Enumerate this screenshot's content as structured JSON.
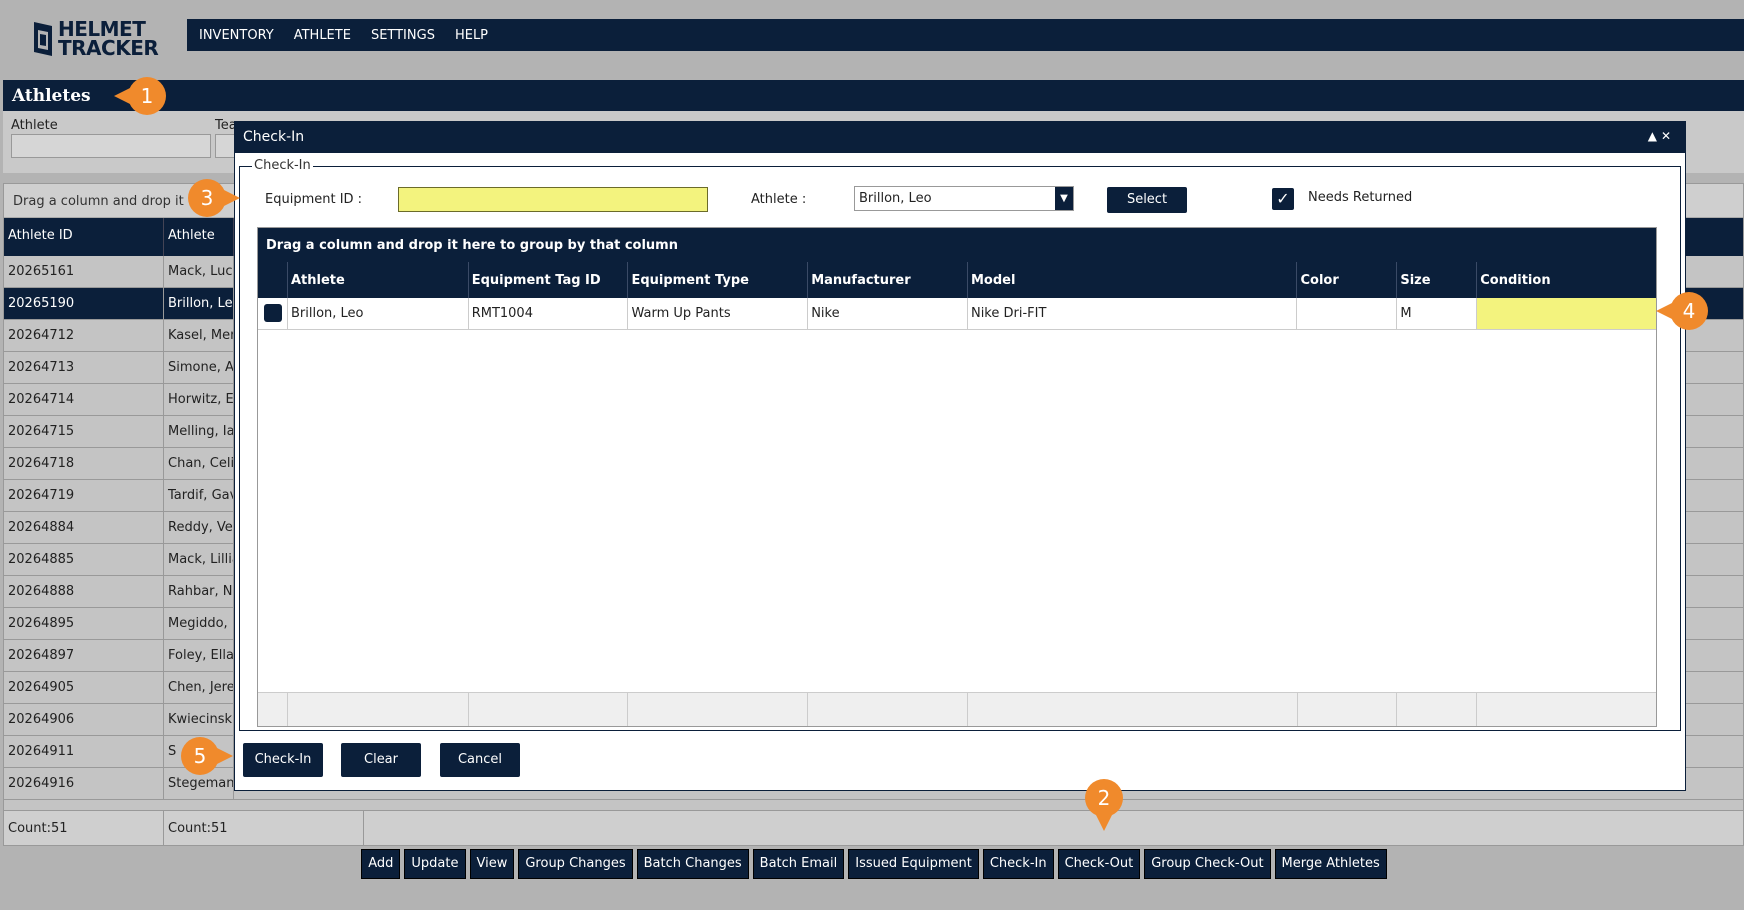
{
  "app": {
    "logo_line1": "HELMET",
    "logo_line2": "TRACKER"
  },
  "topnav": [
    "INVENTORY",
    "ATHLETE",
    "SETTINGS",
    "HELP"
  ],
  "page": {
    "title": "Athletes",
    "filters": {
      "athlete_label": "Athlete",
      "team_label": "Tea"
    },
    "group_hint": "Drag a column and drop it",
    "columns": [
      "Athlete ID",
      "Athlete"
    ],
    "rows": [
      [
        "20265161",
        "Mack, Luca"
      ],
      [
        "20265190",
        "Brillon, Le"
      ],
      [
        "20264712",
        "Kasel, Mer"
      ],
      [
        "20264713",
        "Simone, A"
      ],
      [
        "20264714",
        "Horwitz, E"
      ],
      [
        "20264715",
        "Melling, Ia"
      ],
      [
        "20264718",
        "Chan, Celi"
      ],
      [
        "20264719",
        "Tardif, Gav"
      ],
      [
        "20264884",
        "Reddy, Vel"
      ],
      [
        "20264885",
        "Mack, Lillia"
      ],
      [
        "20264888",
        "Rahbar, Ni"
      ],
      [
        "20264895",
        "Megiddo, I"
      ],
      [
        "20264897",
        "Foley, Ella"
      ],
      [
        "20264905",
        "Chen, Jere"
      ],
      [
        "20264906",
        "Kwiecinski"
      ],
      [
        "20264911",
        "S"
      ],
      [
        "20264916",
        "Stegeman"
      ]
    ],
    "footer_count_1": "Count:51",
    "footer_count_2": "Count:51"
  },
  "actions": [
    "Add",
    "Update",
    "View",
    "Group Changes",
    "Batch Changes",
    "Batch Email",
    "Issued Equipment",
    "Check-In",
    "Check-Out",
    "Group Check-Out",
    "Merge Athletes"
  ],
  "modal": {
    "title": "Check-In",
    "legend": "Check-In",
    "equipment_id_label": "Equipment ID :",
    "equipment_id_value": "",
    "athlete_label": "Athlete :",
    "athlete_value": "Brillon, Leo",
    "select_label": "Select",
    "needs_returned_label": "Needs Returned",
    "needs_returned_checked": true,
    "grid": {
      "group_hint": "Drag a column and drop it here to group by that column",
      "columns": [
        "Athlete",
        "Equipment Tag ID",
        "Equipment Type",
        "Manufacturer",
        "Model",
        "Color",
        "Size",
        "Condition"
      ],
      "rows": [
        {
          "athlete": "Brillon, Leo",
          "tag": "RMT1004",
          "type": "Warm Up Pants",
          "manufacturer": "Nike",
          "model": "Nike Dri-FIT",
          "color": "",
          "size": "M",
          "condition": ""
        }
      ]
    },
    "buttons": {
      "checkin": "Check-In",
      "clear": "Clear",
      "cancel": "Cancel"
    }
  },
  "callouts": [
    "1",
    "2",
    "3",
    "4",
    "5"
  ],
  "colors": {
    "navy": "#0b1f3a",
    "highlight": "#f3f37e",
    "callout": "#f08a2c"
  }
}
